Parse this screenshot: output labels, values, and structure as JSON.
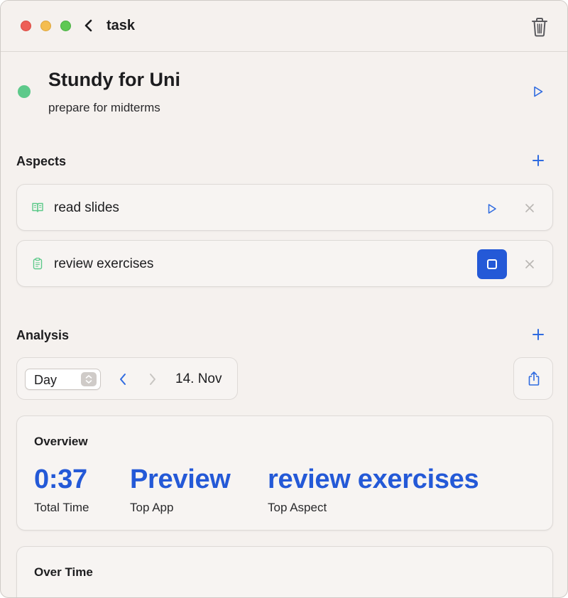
{
  "window": {
    "title": "task"
  },
  "task": {
    "title": "Stundy for Uni",
    "subtitle": "prepare for midterms",
    "status_color": "#5dc98a"
  },
  "aspects": {
    "heading": "Aspects",
    "items": [
      {
        "label": "read slides",
        "icon": "book-icon",
        "state": "idle"
      },
      {
        "label": "review exercises",
        "icon": "clipboard-icon",
        "state": "running"
      }
    ]
  },
  "analysis": {
    "heading": "Analysis",
    "period": {
      "selected": "Day"
    },
    "date": "14. Nov"
  },
  "overview": {
    "heading": "Overview",
    "stats": [
      {
        "value": "0:37",
        "label": "Total Time"
      },
      {
        "value": "Preview",
        "label": "Top App"
      },
      {
        "value": "review exercises",
        "label": "Top Aspect"
      }
    ]
  },
  "over_time": {
    "heading": "Over Time"
  },
  "colors": {
    "accent": "#2459d7",
    "aspect_icon": "#5dc98a",
    "window_bg": "#f5f1ee"
  }
}
